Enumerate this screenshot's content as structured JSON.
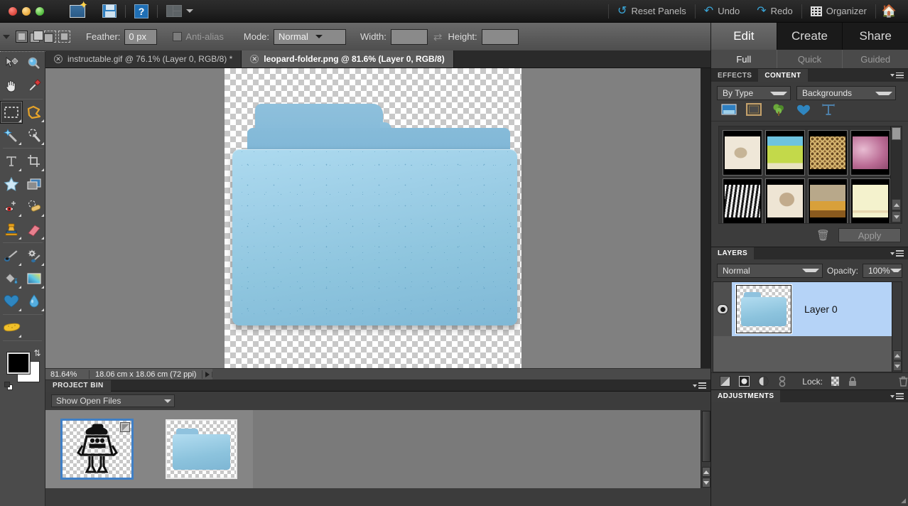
{
  "topbar": {
    "icons": [
      {
        "name": "new-file-icon",
        "label": "New"
      },
      {
        "name": "save-icon",
        "label": "Save"
      },
      {
        "name": "help-icon",
        "label": "?"
      },
      {
        "name": "layout-icon",
        "label": "Layout"
      }
    ],
    "right_items": [
      {
        "name": "reset-panels-button",
        "label": "Reset Panels",
        "icon": "↺"
      },
      {
        "name": "undo-button",
        "label": "Undo",
        "icon": "↶"
      },
      {
        "name": "redo-button",
        "label": "Redo",
        "icon": "↷"
      },
      {
        "name": "organizer-button",
        "label": "Organizer",
        "icon": "grid"
      },
      {
        "name": "home-button",
        "label": "",
        "icon": "home"
      }
    ],
    "accent_color": "#3aa6d8"
  },
  "options_bar": {
    "feather_label": "Feather:",
    "feather_value": "0 px",
    "antialias_label": "Anti-alias",
    "mode_label": "Mode:",
    "mode_value": "Normal",
    "width_label": "Width:",
    "width_value": "",
    "height_label": "Height:",
    "height_value": "",
    "swap_icon": "⇄"
  },
  "tools": [
    {
      "name": "move-tool",
      "glyph": "move"
    },
    {
      "name": "zoom-tool",
      "glyph": "zoom"
    },
    {
      "name": "hand-tool",
      "glyph": "hand"
    },
    {
      "name": "eyedropper-tool",
      "glyph": "eyedropper"
    },
    {
      "name": "rectangular-marquee-tool",
      "glyph": "marquee",
      "selected": true
    },
    {
      "name": "lasso-tool",
      "glyph": "lasso"
    },
    {
      "name": "magic-wand-tool",
      "glyph": "wand"
    },
    {
      "name": "quick-selection-tool",
      "glyph": "quickselect"
    },
    {
      "name": "type-tool",
      "glyph": "type"
    },
    {
      "name": "crop-tool",
      "glyph": "crop"
    },
    {
      "name": "cookie-cutter-tool",
      "glyph": "cookie"
    },
    {
      "name": "straighten-tool",
      "glyph": "straighten"
    },
    {
      "name": "red-eye-removal-tool",
      "glyph": "redeye"
    },
    {
      "name": "healing-brush-tool",
      "glyph": "healing"
    },
    {
      "name": "clone-stamp-tool",
      "glyph": "stamp"
    },
    {
      "name": "eraser-tool",
      "glyph": "eraser"
    },
    {
      "name": "brush-tool",
      "glyph": "brush"
    },
    {
      "name": "smart-brush-tool",
      "glyph": "smartbrush"
    },
    {
      "name": "paint-bucket-tool",
      "glyph": "bucket"
    },
    {
      "name": "gradient-tool",
      "glyph": "gradient"
    },
    {
      "name": "shape-tool",
      "glyph": "shape"
    },
    {
      "name": "blur-tool",
      "glyph": "blur"
    },
    {
      "name": "sponge-tool",
      "glyph": "sponge"
    }
  ],
  "color_swatch": {
    "foreground": "#000000",
    "background": "#ffffff",
    "swap_icon": "⇅"
  },
  "document_tabs": [
    {
      "name": "tab-instructable",
      "label": "instructable.gif @ 76.1% (Layer 0, RGB/8) *",
      "active": false
    },
    {
      "name": "tab-leopard-folder",
      "label": "leopard-folder.png @ 81.6% (Layer 0, RGB/8)",
      "active": true
    }
  ],
  "status_bar": {
    "zoom": "81.64%",
    "dimensions": "18.06 cm x 18.06 cm (72 ppi)"
  },
  "project_bin": {
    "title": "PROJECT BIN",
    "filter_value": "Show Open Files",
    "items": [
      {
        "name": "bin-item-instructable",
        "selected": true
      },
      {
        "name": "bin-item-leopard-folder",
        "selected": false
      }
    ]
  },
  "right_panel": {
    "mode_tabs": [
      {
        "name": "tab-edit",
        "label": "Edit",
        "active": true
      },
      {
        "name": "tab-create",
        "label": "Create",
        "active": false
      },
      {
        "name": "tab-share",
        "label": "Share",
        "active": false
      }
    ],
    "sub_tabs": [
      {
        "name": "tab-full",
        "label": "Full",
        "active": true
      },
      {
        "name": "tab-quick",
        "label": "Quick",
        "active": false
      },
      {
        "name": "tab-guided",
        "label": "Guided",
        "active": false
      }
    ],
    "content_panel": {
      "tabs": [
        {
          "name": "tab-effects",
          "label": "EFFECTS",
          "active": false
        },
        {
          "name": "tab-content",
          "label": "CONTENT",
          "active": true
        }
      ],
      "filter_by": "By Type",
      "filter_type": "Backgrounds",
      "category_icons": [
        {
          "name": "backgrounds-category-icon"
        },
        {
          "name": "frames-category-icon"
        },
        {
          "name": "graphics-category-icon"
        },
        {
          "name": "shapes-category-icon"
        },
        {
          "name": "text-category-icon"
        }
      ],
      "thumbnails": [
        {
          "name": "thumb-africa-map",
          "c1": "#efe7d8",
          "c2": "#c6b496"
        },
        {
          "name": "thumb-beach-scene",
          "c1": "#6ec3e0",
          "c2": "#c3d94a"
        },
        {
          "name": "thumb-leopard-print",
          "c1": "#d9b972",
          "c2": "#6a4a22"
        },
        {
          "name": "thumb-pink-texture",
          "c1": "#d79ab8",
          "c2": "#8f4a6e"
        },
        {
          "name": "thumb-zebra-print",
          "c1": "#f0f0f0",
          "c2": "#1a1a1a"
        },
        {
          "name": "thumb-asia-map",
          "c1": "#eee5d4",
          "c2": "#c2ab8c"
        },
        {
          "name": "thumb-autumn-harvest",
          "c1": "#d8c08a",
          "c2": "#8a5a1e"
        },
        {
          "name": "thumb-cream-border",
          "c1": "#f4f2cd",
          "c2": "#e8e2a8"
        },
        {
          "name": "thumb-row3-a",
          "c1": "#2a2a2a",
          "c2": "#111111"
        },
        {
          "name": "thumb-row3-b",
          "c1": "#2a2a2a",
          "c2": "#111111"
        },
        {
          "name": "thumb-row3-c",
          "c1": "#2a2a2a",
          "c2": "#111111"
        },
        {
          "name": "thumb-row3-d",
          "c1": "#2a2a2a",
          "c2": "#111111"
        }
      ],
      "trash_icon": "🗑",
      "apply_label": "Apply"
    },
    "layers_panel": {
      "title": "LAYERS",
      "blend_mode": "Normal",
      "opacity_label": "Opacity:",
      "opacity_value": "100%",
      "layers": [
        {
          "name": "layer-row-layer0",
          "label": "Layer 0",
          "visible": true,
          "selected": true
        }
      ],
      "lock_label": "Lock:",
      "footer_icons": [
        {
          "name": "new-layer-icon"
        },
        {
          "name": "new-adjustment-layer-icon"
        },
        {
          "name": "new-fill-layer-icon"
        },
        {
          "name": "link-layers-icon"
        },
        {
          "name": "lock-transparency-icon"
        },
        {
          "name": "lock-all-icon"
        },
        {
          "name": "delete-layer-icon"
        }
      ]
    },
    "adjustments_panel": {
      "title": "ADJUSTMENTS"
    }
  },
  "colors": {
    "accent_blue": "#3aa6d8",
    "panel_bg": "#3c3c3c",
    "canvas_bg": "#808080",
    "selection_blue": "#b5d3f7",
    "folder_blue": "#8ec5de"
  }
}
